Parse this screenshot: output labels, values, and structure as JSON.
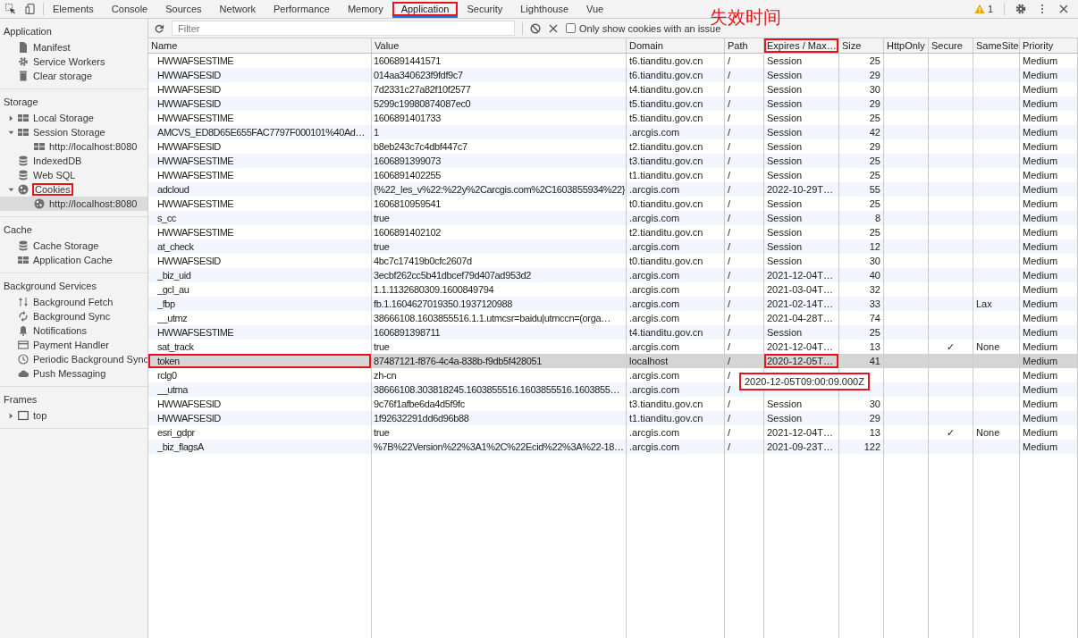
{
  "devtools_tabs": [
    {
      "label": "Elements",
      "selected": false,
      "outlined": false
    },
    {
      "label": "Console",
      "selected": false,
      "outlined": false
    },
    {
      "label": "Sources",
      "selected": false,
      "outlined": false
    },
    {
      "label": "Network",
      "selected": false,
      "outlined": false
    },
    {
      "label": "Performance",
      "selected": false,
      "outlined": false
    },
    {
      "label": "Memory",
      "selected": false,
      "outlined": false
    },
    {
      "label": "Application",
      "selected": true,
      "outlined": true
    },
    {
      "label": "Security",
      "selected": false,
      "outlined": false
    },
    {
      "label": "Lighthouse",
      "selected": false,
      "outlined": false
    },
    {
      "label": "Vue",
      "selected": false,
      "outlined": false
    }
  ],
  "warnings_count": "1",
  "sidebar": [
    {
      "title": "Application",
      "items": [
        {
          "label": "Manifest",
          "kind": "file",
          "selected": false,
          "outlined": false
        },
        {
          "label": "Service Workers",
          "kind": "gear",
          "selected": false,
          "outlined": false
        },
        {
          "label": "Clear storage",
          "kind": "trash",
          "selected": false,
          "outlined": false
        }
      ]
    },
    {
      "title": "Storage",
      "items": [
        {
          "label": "Local Storage",
          "kind": "grid",
          "expanded": false,
          "selected": false,
          "outlined": false
        },
        {
          "label": "Session Storage",
          "kind": "grid",
          "expanded": true,
          "selected": false,
          "outlined": false,
          "children": [
            {
              "label": "http://localhost:8080",
              "kind": "grid",
              "selected": false,
              "outlined": false
            }
          ]
        },
        {
          "label": "IndexedDB",
          "kind": "database",
          "selected": false,
          "outlined": false
        },
        {
          "label": "Web SQL",
          "kind": "database",
          "selected": false,
          "outlined": false
        },
        {
          "label": "Cookies",
          "kind": "cookie",
          "expanded": true,
          "selected": false,
          "outlined": true,
          "children": [
            {
              "label": "http://localhost:8080",
              "kind": "cookie",
              "selected": true,
              "outlined": false
            }
          ]
        }
      ]
    },
    {
      "title": "Cache",
      "items": [
        {
          "label": "Cache Storage",
          "kind": "database",
          "selected": false,
          "outlined": false
        },
        {
          "label": "Application Cache",
          "kind": "grid",
          "selected": false,
          "outlined": false
        }
      ]
    },
    {
      "title": "Background Services",
      "items": [
        {
          "label": "Background Fetch",
          "kind": "updown",
          "selected": false,
          "outlined": false
        },
        {
          "label": "Background Sync",
          "kind": "sync",
          "selected": false,
          "outlined": false
        },
        {
          "label": "Notifications",
          "kind": "bell",
          "selected": false,
          "outlined": false
        },
        {
          "label": "Payment Handler",
          "kind": "card",
          "selected": false,
          "outlined": false
        },
        {
          "label": "Periodic Background Sync",
          "kind": "clock",
          "selected": false,
          "outlined": false
        },
        {
          "label": "Push Messaging",
          "kind": "cloud",
          "selected": false,
          "outlined": false
        }
      ]
    },
    {
      "title": "Frames",
      "items": [
        {
          "label": "top",
          "kind": "frame",
          "expanded": false,
          "selected": false,
          "outlined": false
        }
      ]
    }
  ],
  "toolbar": {
    "filter_placeholder": "Filter",
    "only_issues": {
      "label": "Only show cookies with an issue",
      "checked": false
    }
  },
  "annotation_text": "失效时间",
  "table": {
    "columns": [
      {
        "label": "Name",
        "outlined": false
      },
      {
        "label": "Value",
        "outlined": false
      },
      {
        "label": "Domain",
        "outlined": false
      },
      {
        "label": "Path",
        "outlined": false
      },
      {
        "label": "Expires / Max…",
        "outlined": true
      },
      {
        "label": "Size",
        "outlined": false
      },
      {
        "label": "HttpOnly",
        "outlined": false
      },
      {
        "label": "Secure",
        "outlined": false
      },
      {
        "label": "SameSite",
        "outlined": false
      },
      {
        "label": "Priority",
        "outlined": false
      }
    ],
    "rows": [
      {
        "name": "HWWAFSESTIME",
        "value": "1606891441571",
        "domain": "t6.tianditu.gov.cn",
        "path": "/",
        "expires": "Session",
        "size": "25",
        "priority": "Medium",
        "selected": false
      },
      {
        "name": "HWWAFSESID",
        "value": "014aa340623f9fdf9c7",
        "domain": "t6.tianditu.gov.cn",
        "path": "/",
        "expires": "Session",
        "size": "29",
        "priority": "Medium",
        "selected": false
      },
      {
        "name": "HWWAFSESID",
        "value": "7d2331c27a82f10f2577",
        "domain": "t4.tianditu.gov.cn",
        "path": "/",
        "expires": "Session",
        "size": "30",
        "priority": "Medium",
        "selected": false
      },
      {
        "name": "HWWAFSESID",
        "value": "5299c19980874087ec0",
        "domain": "t5.tianditu.gov.cn",
        "path": "/",
        "expires": "Session",
        "size": "29",
        "priority": "Medium",
        "selected": false
      },
      {
        "name": "HWWAFSESTIME",
        "value": "1606891401733",
        "domain": "t5.tianditu.gov.cn",
        "path": "/",
        "expires": "Session",
        "size": "25",
        "priority": "Medium",
        "selected": false
      },
      {
        "name": "AMCVS_ED8D65E655FAC7797F000101%40Ad…",
        "value": "1",
        "domain": ".arcgis.com",
        "path": "/",
        "expires": "Session",
        "size": "42",
        "priority": "Medium",
        "selected": false
      },
      {
        "name": "HWWAFSESID",
        "value": "b8eb243c7c4dbf447c7",
        "domain": "t2.tianditu.gov.cn",
        "path": "/",
        "expires": "Session",
        "size": "29",
        "priority": "Medium",
        "selected": false
      },
      {
        "name": "HWWAFSESTIME",
        "value": "1606891399073",
        "domain": "t3.tianditu.gov.cn",
        "path": "/",
        "expires": "Session",
        "size": "25",
        "priority": "Medium",
        "selected": false
      },
      {
        "name": "HWWAFSESTIME",
        "value": "1606891402255",
        "domain": "t1.tianditu.gov.cn",
        "path": "/",
        "expires": "Session",
        "size": "25",
        "priority": "Medium",
        "selected": false
      },
      {
        "name": "adcloud",
        "value": "{%22_les_v%22:%22y%2Carcgis.com%2C1603855934%22}",
        "domain": ".arcgis.com",
        "path": "/",
        "expires": "2022-10-29T…",
        "size": "55",
        "priority": "Medium",
        "selected": false
      },
      {
        "name": "HWWAFSESTIME",
        "value": "1606810959541",
        "domain": "t0.tianditu.gov.cn",
        "path": "/",
        "expires": "Session",
        "size": "25",
        "priority": "Medium",
        "selected": false
      },
      {
        "name": "s_cc",
        "value": "true",
        "domain": ".arcgis.com",
        "path": "/",
        "expires": "Session",
        "size": "8",
        "priority": "Medium",
        "selected": false
      },
      {
        "name": "HWWAFSESTIME",
        "value": "1606891402102",
        "domain": "t2.tianditu.gov.cn",
        "path": "/",
        "expires": "Session",
        "size": "25",
        "priority": "Medium",
        "selected": false
      },
      {
        "name": "at_check",
        "value": "true",
        "domain": ".arcgis.com",
        "path": "/",
        "expires": "Session",
        "size": "12",
        "priority": "Medium",
        "selected": false
      },
      {
        "name": "HWWAFSESID",
        "value": "4bc7c17419b0cfc2607d",
        "domain": "t0.tianditu.gov.cn",
        "path": "/",
        "expires": "Session",
        "size": "30",
        "priority": "Medium",
        "selected": false
      },
      {
        "name": "_biz_uid",
        "value": "3ecbf262cc5b41dbcef79d407ad953d2",
        "domain": ".arcgis.com",
        "path": "/",
        "expires": "2021-12-04T…",
        "size": "40",
        "priority": "Medium",
        "selected": false
      },
      {
        "name": "_gcl_au",
        "value": "1.1.1132680309.1600849794",
        "domain": ".arcgis.com",
        "path": "/",
        "expires": "2021-03-04T…",
        "size": "32",
        "priority": "Medium",
        "selected": false
      },
      {
        "name": "_fbp",
        "value": "fb.1.1604627019350.1937120988",
        "domain": ".arcgis.com",
        "path": "/",
        "expires": "2021-02-14T…",
        "size": "33",
        "samesite": "Lax",
        "priority": "Medium",
        "selected": false
      },
      {
        "name": "__utmz",
        "value": "38666108.1603855516.1.1.utmcsr=baidu|utmccn=(orga…",
        "domain": ".arcgis.com",
        "path": "/",
        "expires": "2021-04-28T…",
        "size": "74",
        "priority": "Medium",
        "selected": false
      },
      {
        "name": "HWWAFSESTIME",
        "value": "1606891398711",
        "domain": "t4.tianditu.gov.cn",
        "path": "/",
        "expires": "Session",
        "size": "25",
        "priority": "Medium",
        "selected": false
      },
      {
        "name": "sat_track",
        "value": "true",
        "domain": ".arcgis.com",
        "path": "/",
        "expires": "2021-12-04T…",
        "size": "13",
        "secure": "✓",
        "samesite": "None",
        "priority": "Medium",
        "selected": false
      },
      {
        "name": "token",
        "value": "87487121-f876-4c4a-838b-f9db5f428051",
        "domain": "localhost",
        "path": "/",
        "expires": "2020-12-05T…",
        "size": "41",
        "priority": "Medium",
        "selected": true,
        "outlined": true
      },
      {
        "name": "rclg0",
        "value": "zh-cn",
        "domain": ".arcgis.com",
        "path": "/",
        "priority": "Medium",
        "selected": false
      },
      {
        "name": "__utma",
        "value": "38666108.303818245.1603855516.1603855516.1603855…",
        "domain": ".arcgis.com",
        "path": "/",
        "priority": "Medium",
        "selected": false
      },
      {
        "name": "HWWAFSESID",
        "value": "9c76f1afbe6da4d5f9fc",
        "domain": "t3.tianditu.gov.cn",
        "path": "/",
        "expires": "Session",
        "size": "30",
        "priority": "Medium",
        "selected": false
      },
      {
        "name": "HWWAFSESID",
        "value": "1f92632291dd6d96b88",
        "domain": "t1.tianditu.gov.cn",
        "path": "/",
        "expires": "Session",
        "size": "29",
        "priority": "Medium",
        "selected": false
      },
      {
        "name": "esri_gdpr",
        "value": "true",
        "domain": ".arcgis.com",
        "path": "/",
        "expires": "2021-12-04T…",
        "size": "13",
        "secure": "✓",
        "samesite": "None",
        "priority": "Medium",
        "selected": false
      },
      {
        "name": "_biz_flagsA",
        "value": "%7B%22Version%22%3A1%2C%22Ecid%22%3A%22-18…",
        "domain": ".arcgis.com",
        "path": "/",
        "expires": "2021-09-23T…",
        "size": "122",
        "priority": "Medium",
        "selected": false
      }
    ],
    "tooltip": {
      "text": "2020-12-05T09:00:09.000Z",
      "outlined": true
    }
  }
}
